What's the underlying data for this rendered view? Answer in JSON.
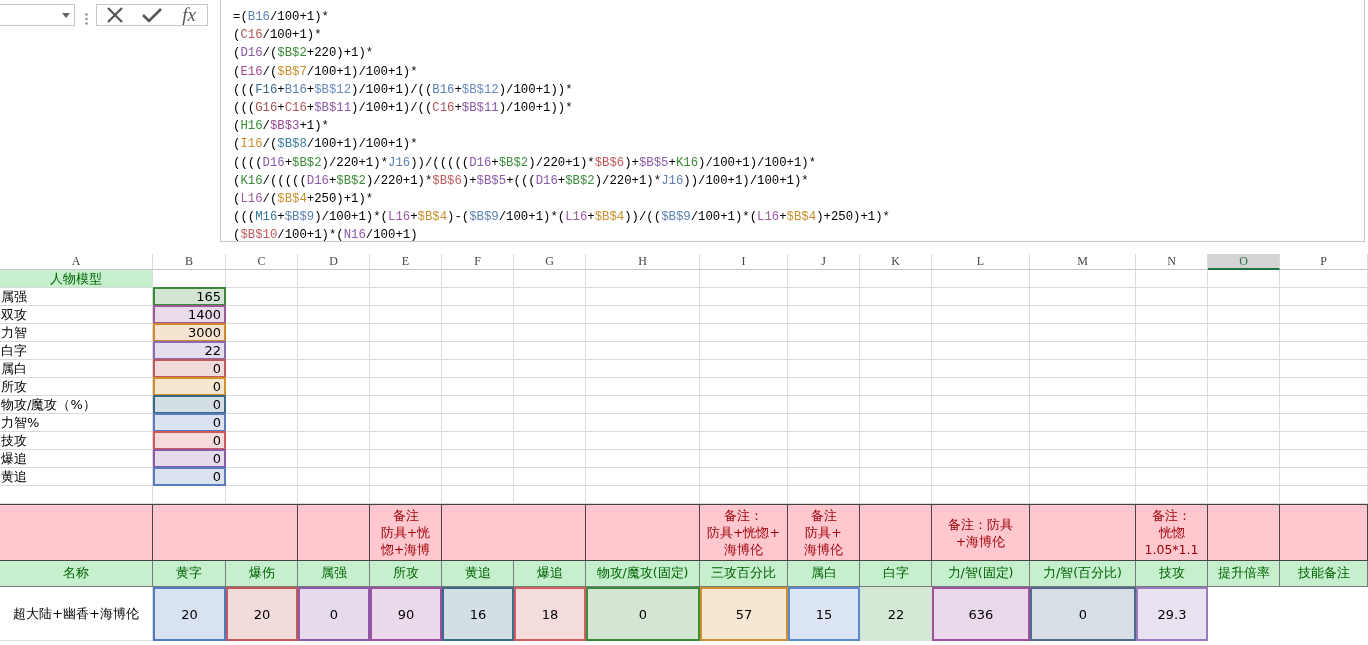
{
  "formula_bar": {
    "function_label": "fx",
    "lines": [
      [
        {
          "text": "=("
        },
        {
          "text": "B16",
          "color": "#5b7fb0"
        },
        {
          "text": "/100+1)*"
        }
      ],
      [
        {
          "text": "("
        },
        {
          "text": "C16",
          "color": "#b05656"
        },
        {
          "text": "/100+1)*"
        }
      ],
      [
        {
          "text": "("
        },
        {
          "text": "D16",
          "color": "#8a5aa8"
        },
        {
          "text": "/("
        },
        {
          "text": "$B$2",
          "color": "#3a8a3a"
        },
        {
          "text": "+220)+1)*"
        }
      ],
      [
        {
          "text": "("
        },
        {
          "text": "E16",
          "color": "#a04f8a"
        },
        {
          "text": "/("
        },
        {
          "text": "$B$7",
          "color": "#c8902c"
        },
        {
          "text": "/100+1)/100+1)*"
        }
      ],
      [
        {
          "text": "((("
        },
        {
          "text": "F16",
          "color": "#3a6a8a"
        },
        {
          "text": "+"
        },
        {
          "text": "B16",
          "color": "#5b7fb0"
        },
        {
          "text": "+"
        },
        {
          "text": "$B$12",
          "color": "#6a8ac0"
        },
        {
          "text": ")/100+1)/(("
        },
        {
          "text": "B16",
          "color": "#5b7fb0"
        },
        {
          "text": "+"
        },
        {
          "text": "$B$12",
          "color": "#6a8ac0"
        },
        {
          "text": ")/100+1))*"
        }
      ],
      [
        {
          "text": "((("
        },
        {
          "text": "G16",
          "color": "#a05050"
        },
        {
          "text": "+"
        },
        {
          "text": "C16",
          "color": "#b05656"
        },
        {
          "text": "+"
        },
        {
          "text": "$B$11",
          "color": "#8a5aa8"
        },
        {
          "text": ")/100+1)/(("
        },
        {
          "text": "C16",
          "color": "#b05656"
        },
        {
          "text": "+"
        },
        {
          "text": "$B$11",
          "color": "#8a5aa8"
        },
        {
          "text": ")/100+1))*"
        }
      ],
      [
        {
          "text": "("
        },
        {
          "text": "H16",
          "color": "#3a8a3a"
        },
        {
          "text": "/"
        },
        {
          "text": "$B$3",
          "color": "#9a4a9a"
        },
        {
          "text": "+1)*"
        }
      ],
      [
        {
          "text": "("
        },
        {
          "text": "I16",
          "color": "#c8902c"
        },
        {
          "text": "/("
        },
        {
          "text": "$B$8",
          "color": "#3a7a9a"
        },
        {
          "text": "/100+1)/100+1)*"
        }
      ],
      [
        {
          "text": "(((("
        },
        {
          "text": "D16",
          "color": "#8a5aa8"
        },
        {
          "text": "+"
        },
        {
          "text": "$B$2",
          "color": "#3a8a3a"
        },
        {
          "text": ")/220+1)*"
        },
        {
          "text": "J16",
          "color": "#5b7fb0"
        },
        {
          "text": "))/((((("
        },
        {
          "text": "D16",
          "color": "#8a5aa8"
        },
        {
          "text": "+"
        },
        {
          "text": "$B$2",
          "color": "#3a8a3a"
        },
        {
          "text": ")/220+1)*"
        },
        {
          "text": "$B$6",
          "color": "#c05a5a"
        },
        {
          "text": ")+"
        },
        {
          "text": "$B$5",
          "color": "#8a5aa8"
        },
        {
          "text": "+"
        },
        {
          "text": "K16",
          "color": "#3a8a3a"
        },
        {
          "text": ")/100+1)/100+1)*"
        }
      ],
      [
        {
          "text": "("
        },
        {
          "text": "K16",
          "color": "#3a8a3a"
        },
        {
          "text": "/((((("
        },
        {
          "text": "D16",
          "color": "#8a5aa8"
        },
        {
          "text": "+"
        },
        {
          "text": "$B$2",
          "color": "#3a8a3a"
        },
        {
          "text": ")/220+1)*"
        },
        {
          "text": "$B$6",
          "color": "#c05a5a"
        },
        {
          "text": ")+"
        },
        {
          "text": "$B$5",
          "color": "#8a5aa8"
        },
        {
          "text": "+((("
        },
        {
          "text": "D16",
          "color": "#8a5aa8"
        },
        {
          "text": "+"
        },
        {
          "text": "$B$2",
          "color": "#3a8a3a"
        },
        {
          "text": ")/220+1)*"
        },
        {
          "text": "J16",
          "color": "#5b7fb0"
        },
        {
          "text": "))/100+1)/100+1)*"
        }
      ],
      [
        {
          "text": "("
        },
        {
          "text": "L16",
          "color": "#9a5aa0"
        },
        {
          "text": "/("
        },
        {
          "text": "$B$4",
          "color": "#c8902c"
        },
        {
          "text": "+250)+1)*"
        }
      ],
      [
        {
          "text": "((("
        },
        {
          "text": "M16",
          "color": "#3a7a9a"
        },
        {
          "text": "+"
        },
        {
          "text": "$B$9",
          "color": "#5b7fb0"
        },
        {
          "text": ")/100+1)*("
        },
        {
          "text": "L16",
          "color": "#9a5aa0"
        },
        {
          "text": "+"
        },
        {
          "text": "$B$4",
          "color": "#c8902c"
        },
        {
          "text": ")-("
        },
        {
          "text": "$B$9",
          "color": "#5b7fb0"
        },
        {
          "text": "/100+1)*("
        },
        {
          "text": "L16",
          "color": "#9a5aa0"
        },
        {
          "text": "+"
        },
        {
          "text": "$B$4",
          "color": "#c8902c"
        },
        {
          "text": "))/(("
        },
        {
          "text": "$B$9",
          "color": "#5b7fb0"
        },
        {
          "text": "/100+1)*("
        },
        {
          "text": "L16",
          "color": "#9a5aa0"
        },
        {
          "text": "+"
        },
        {
          "text": "$B$4",
          "color": "#c8902c"
        },
        {
          "text": ")+250)+1)*"
        }
      ],
      [
        {
          "text": "("
        },
        {
          "text": "$B$10",
          "color": "#c05a5a"
        },
        {
          "text": "/100+1)*("
        },
        {
          "text": "N16",
          "color": "#8a5aa8"
        },
        {
          "text": "/100+1)"
        }
      ]
    ]
  },
  "column_headers": [
    {
      "label": "A",
      "selected": false
    },
    {
      "label": "B",
      "selected": false
    },
    {
      "label": "C",
      "selected": false
    },
    {
      "label": "D",
      "selected": false
    },
    {
      "label": "E",
      "selected": false
    },
    {
      "label": "F",
      "selected": false
    },
    {
      "label": "G",
      "selected": false
    },
    {
      "label": "H",
      "selected": false
    },
    {
      "label": "I",
      "selected": false
    },
    {
      "label": "J",
      "selected": false
    },
    {
      "label": "K",
      "selected": false
    },
    {
      "label": "L",
      "selected": false
    },
    {
      "label": "M",
      "selected": false
    },
    {
      "label": "N",
      "selected": false
    },
    {
      "label": "O",
      "selected": true
    },
    {
      "label": "P",
      "selected": false
    }
  ],
  "model": {
    "title": "人物模型",
    "rows": [
      {
        "label": "属强",
        "value": "165",
        "color": "#3a8a3a"
      },
      {
        "label": "双攻",
        "value": "1400",
        "color": "#9a5a9a"
      },
      {
        "label": "力智",
        "value": "3000",
        "color": "#d0882a"
      },
      {
        "label": "白字",
        "value": "22",
        "color": "#8a6ab0"
      },
      {
        "label": "属白",
        "value": "0",
        "color": "#c05a5a"
      },
      {
        "label": "所攻",
        "value": "0",
        "color": "#d0902a"
      },
      {
        "label": "物攻/魔攻（%）",
        "value": "0",
        "color": "#3a6a8a"
      },
      {
        "label": "力智%",
        "value": "0",
        "color": "#5a7ac0"
      },
      {
        "label": "技攻",
        "value": "0",
        "color": "#d05a5a"
      },
      {
        "label": "爆追",
        "value": "0",
        "color": "#8a5aa8"
      },
      {
        "label": "黄追",
        "value": "0",
        "color": "#5a7ac0"
      }
    ]
  },
  "table": {
    "notes": [
      {
        "lines": [
          "备注",
          "防具+恍",
          "惚+海博"
        ]
      },
      {
        "lines": [
          "备注：",
          "防具+恍惚+",
          "海博伦"
        ]
      },
      {
        "lines": [
          "备注",
          "防具+",
          "海博伦"
        ]
      },
      {
        "lines": [
          "备注：防具",
          "+海博伦"
        ]
      },
      {
        "lines": [
          "备注：",
          "恍惚",
          "1.05*1.1"
        ]
      }
    ],
    "columns": [
      "名称",
      "黄字",
      "爆伤",
      "属强",
      "所攻",
      "黄追",
      "爆追",
      "物攻/魔攻(固定)",
      "三攻百分比",
      "属白",
      "白字",
      "力/智(固定)",
      "力/智(百分比)",
      "技攻",
      "提升倍率",
      "技能备注"
    ],
    "row": {
      "name": "超大陆+幽香+海博伦",
      "values": [
        {
          "value": "20",
          "color": "#4f7ac0",
          "highlighted": true
        },
        {
          "value": "20",
          "color": "#c05a5a",
          "highlighted": true
        },
        {
          "value": "0",
          "color": "#8a5aa8",
          "highlighted": true
        },
        {
          "value": "90",
          "color": "#a050a0",
          "highlighted": true
        },
        {
          "value": "16",
          "color": "#3a6a8a",
          "highlighted": true
        },
        {
          "value": "18",
          "color": "#d06060",
          "highlighted": true
        },
        {
          "value": "0",
          "color": "#3a8a3a",
          "highlighted": true
        },
        {
          "value": "57",
          "color": "#d09030",
          "highlighted": true
        },
        {
          "value": "15",
          "color": "#5a8ad0",
          "highlighted": true
        },
        {
          "value": "22",
          "color": "#d5e8d5",
          "highlighted": false
        },
        {
          "value": "636",
          "color": "#a050a0",
          "highlighted": true
        },
        {
          "value": "0",
          "color": "#4f6a8a",
          "highlighted": true
        },
        {
          "value": "29.3",
          "color": "#9a7ac0",
          "highlighted": true
        }
      ]
    }
  }
}
